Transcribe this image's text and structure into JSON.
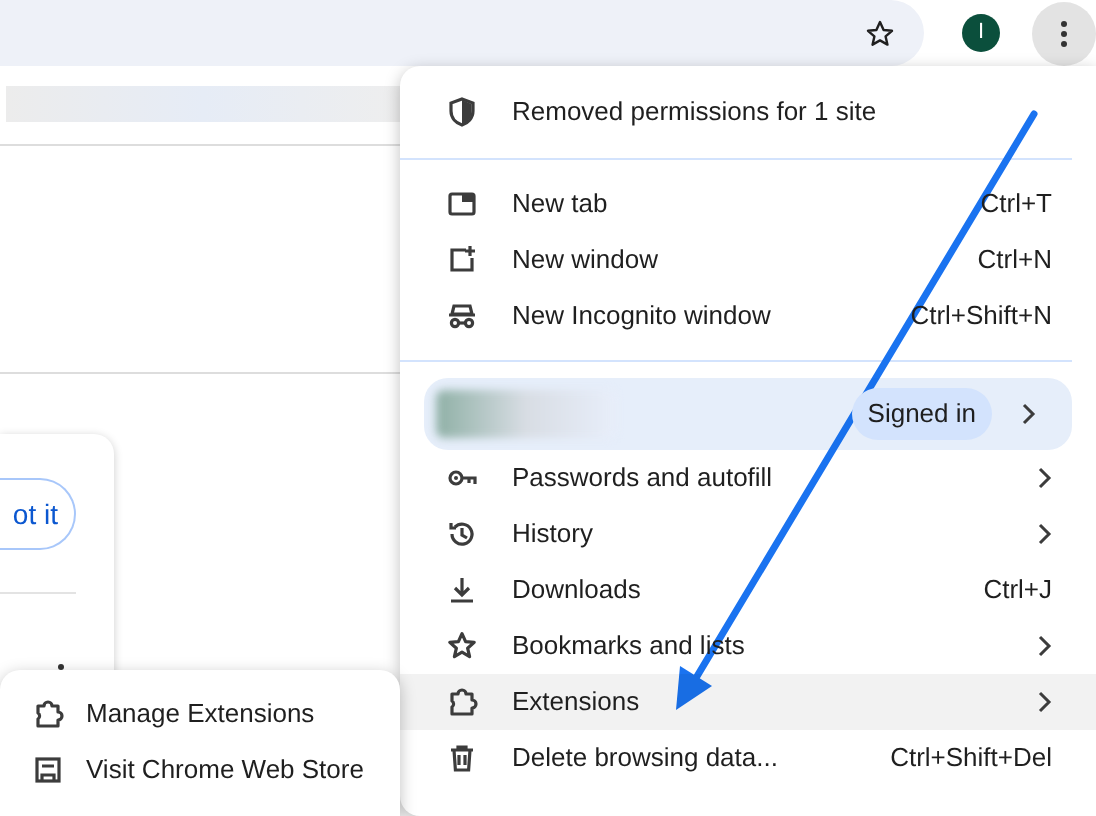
{
  "toolbar": {
    "avatar_initial": "I"
  },
  "page": {
    "card_button": "ot it"
  },
  "menu": {
    "items": [
      {
        "kind": "notice",
        "label": "Removed permissions for 1 site",
        "selected": false
      },
      {
        "kind": "divider"
      },
      {
        "kind": "item",
        "label": "New tab",
        "shortcut": "Ctrl+T",
        "submenu": false,
        "selected": false
      },
      {
        "kind": "item",
        "label": "New window",
        "shortcut": "Ctrl+N",
        "submenu": false,
        "selected": false
      },
      {
        "kind": "item",
        "label": "New Incognito window",
        "shortcut": "Ctrl+Shift+N",
        "submenu": false,
        "selected": false
      },
      {
        "kind": "divider"
      },
      {
        "kind": "profile",
        "status": "Signed in",
        "submenu": true,
        "selected": false
      },
      {
        "kind": "item",
        "label": "Passwords and autofill",
        "submenu": true,
        "selected": false
      },
      {
        "kind": "item",
        "label": "History",
        "submenu": true,
        "selected": false
      },
      {
        "kind": "item",
        "label": "Downloads",
        "shortcut": "Ctrl+J",
        "submenu": false,
        "selected": false
      },
      {
        "kind": "item",
        "label": "Bookmarks and lists",
        "submenu": true,
        "selected": false
      },
      {
        "kind": "item",
        "label": "Extensions",
        "submenu": true,
        "selected": true
      },
      {
        "kind": "item",
        "label": "Delete browsing data...",
        "shortcut": "Ctrl+Shift+Del",
        "submenu": false,
        "selected": false
      }
    ]
  },
  "submenu": {
    "items": [
      {
        "label": "Manage Extensions",
        "selected": false
      },
      {
        "label": "Visit Chrome Web Store",
        "selected": false
      }
    ]
  }
}
